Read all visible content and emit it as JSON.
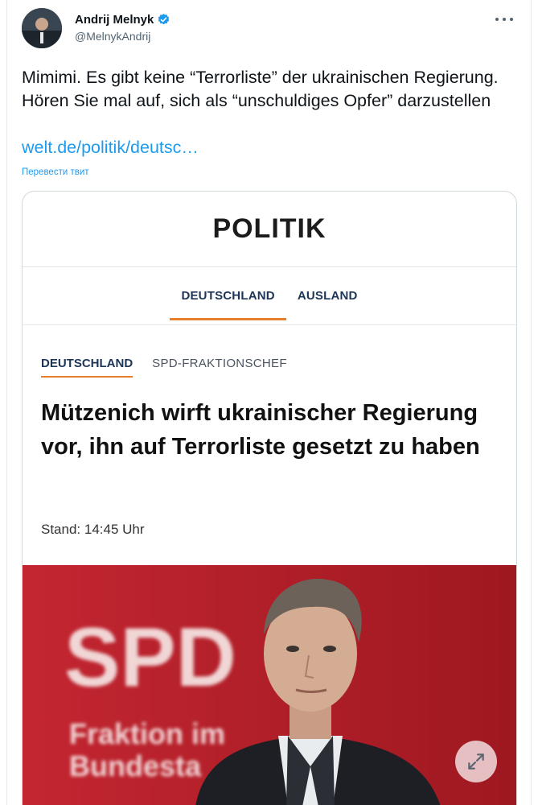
{
  "author": {
    "name": "Andrij Melnyk",
    "handle": "@MelnykAndrij"
  },
  "tweet": {
    "text": "Mimimi. Es gibt keine “Terrorliste” der ukrainischen Regierung. Hören Sie mal auf, sich als “unschuldiges Opfer” darzustellen",
    "link": "welt.de/politik/deutsc…",
    "translate": "Перевести твит"
  },
  "card": {
    "masthead": "POLITIK",
    "nav": [
      {
        "label": "DEUTSCHLAND",
        "active": true
      },
      {
        "label": "AUSLAND",
        "active": false
      }
    ],
    "kicker_primary": "DEUTSCHLAND",
    "kicker_secondary": "SPD-FRAKTIONSCHEF",
    "headline": "Mützenich wirft ukrainischer Regierung vor, ihn auf Terrorliste gesetzt zu haben",
    "stand": "Stand: 14:45 Uhr"
  },
  "photo": {
    "backdrop_brand": "SPD",
    "backdrop_line1": "Fraktion im",
    "backdrop_line2": "Bundesta"
  },
  "icons": {
    "verified": "verified-badge-icon",
    "more": "more-options-icon",
    "expand": "expand-icon"
  },
  "colors": {
    "accent_link": "#1d9bf0",
    "nav_underline": "#e97f2b",
    "spd_red": "#b5202a"
  }
}
